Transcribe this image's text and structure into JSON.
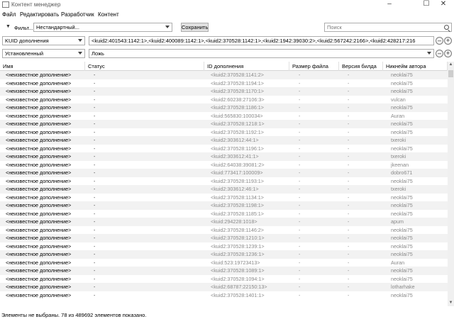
{
  "window": {
    "title": "Контент менеджер",
    "minimize": "–",
    "maximize": "☐",
    "close": "✕"
  },
  "menu": [
    "Файл",
    "Редактировать",
    "Разработчик",
    "Контент"
  ],
  "filter_bar": {
    "toggle": "▼",
    "label": "Фильт...",
    "preset": "Нестандартный...",
    "save_label": "Сохранить",
    "search_placeholder": "Поиск"
  },
  "filter_rows": [
    {
      "field": "KUID дополнения",
      "value": "<kuid2:401543:1142:1>,<kuid2:400089:1142:1>,<kuid2:370528:1142:1>,<kuid2:1942:39030:2>,<kuid2:567242:2166>,<kuid2:428217:216"
    },
    {
      "field": "Установленный",
      "value": "Ложь"
    }
  ],
  "row_buttons": {
    "remove": "–",
    "add": "+"
  },
  "columns": [
    "Имя",
    "Статус",
    "ID дополнения",
    "Размер файла",
    "Версия билда",
    "Никнейм автора"
  ],
  "rows": [
    {
      "name": "<неизвестное дополнение>",
      "status": "-",
      "kuid": "<kuid2:370528:1141:2>",
      "size": "-",
      "build": "-",
      "author": "neoklai75"
    },
    {
      "name": "<неизвестное дополнение>",
      "status": "-",
      "kuid": "<kuid2:370528:1194:1>",
      "size": "-",
      "build": "-",
      "author": "neoklai75"
    },
    {
      "name": "<неизвестное дополнение>",
      "status": "-",
      "kuid": "<kuid2:370528:1170:1>",
      "size": "-",
      "build": "-",
      "author": "neoklai75"
    },
    {
      "name": "<неизвестное дополнение>",
      "status": "-",
      "kuid": "<kuid2:60238:27106:3>",
      "size": "-",
      "build": "-",
      "author": "vulcan"
    },
    {
      "name": "<неизвестное дополнение>",
      "status": "-",
      "kuid": "<kuid2:370528:1186:1>",
      "size": "-",
      "build": "-",
      "author": "neoklai75"
    },
    {
      "name": "<неизвестное дополнение>",
      "status": "-",
      "kuid": "<kuid:565830:100034>",
      "size": "-",
      "build": "-",
      "author": "Auran"
    },
    {
      "name": "<неизвестное дополнение>",
      "status": "-",
      "kuid": "<kuid2:370528:1218:1>",
      "size": "-",
      "build": "-",
      "author": "neoklai75"
    },
    {
      "name": "<неизвестное дополнение>",
      "status": "-",
      "kuid": "<kuid2:370528:1192:1>",
      "size": "-",
      "build": "-",
      "author": "neoklai75"
    },
    {
      "name": "<неизвестное дополнение>",
      "status": "-",
      "kuid": "<kuid2:303612:44:1>",
      "size": "-",
      "build": "-",
      "author": "txeroki"
    },
    {
      "name": "<неизвестное дополнение>",
      "status": "-",
      "kuid": "<kuid2:370528:1196:1>",
      "size": "-",
      "build": "-",
      "author": "neoklai75"
    },
    {
      "name": "<неизвестное дополнение>",
      "status": "-",
      "kuid": "<kuid2:303612:41:1>",
      "size": "-",
      "build": "-",
      "author": "txeroki"
    },
    {
      "name": "<неизвестное дополнение>",
      "status": "-",
      "kuid": "<kuid2:64038:39081:2>",
      "size": "-",
      "build": "-",
      "author": "jkeenan"
    },
    {
      "name": "<неизвестное дополнение>",
      "status": "-",
      "kuid": "<kuid:773417:100009>",
      "size": "-",
      "build": "-",
      "author": "dobro671"
    },
    {
      "name": "<неизвестное дополнение>",
      "status": "-",
      "kuid": "<kuid2:370528:1193:1>",
      "size": "-",
      "build": "-",
      "author": "neoklai75"
    },
    {
      "name": "<неизвестное дополнение>",
      "status": "-",
      "kuid": "<kuid2:303612:46:1>",
      "size": "-",
      "build": "-",
      "author": "txeroki"
    },
    {
      "name": "<неизвестное дополнение>",
      "status": "-",
      "kuid": "<kuid2:370528:1134:1>",
      "size": "-",
      "build": "-",
      "author": "neoklai75"
    },
    {
      "name": "<неизвестное дополнение>",
      "status": "-",
      "kuid": "<kuid2:370528:1198:1>",
      "size": "-",
      "build": "-",
      "author": "neoklai75"
    },
    {
      "name": "<неизвестное дополнение>",
      "status": "-",
      "kuid": "<kuid2:370528:1185:1>",
      "size": "-",
      "build": "-",
      "author": "neoklai75"
    },
    {
      "name": "<неизвестное дополнение>",
      "status": "-",
      "kuid": "<kuid:294228:1018>",
      "size": "-",
      "build": "-",
      "author": "apum"
    },
    {
      "name": "<неизвестное дополнение>",
      "status": "-",
      "kuid": "<kuid2:370528:1146:2>",
      "size": "-",
      "build": "-",
      "author": "neoklai75"
    },
    {
      "name": "<неизвестное дополнение>",
      "status": "-",
      "kuid": "<kuid2:370528:1210:1>",
      "size": "-",
      "build": "-",
      "author": "neoklai75"
    },
    {
      "name": "<неизвестное дополнение>",
      "status": "-",
      "kuid": "<kuid2:370528:1239:1>",
      "size": "-",
      "build": "-",
      "author": "neoklai75"
    },
    {
      "name": "<неизвестное дополнение>",
      "status": "-",
      "kuid": "<kuid2:370528:1236:1>",
      "size": "-",
      "build": "-",
      "author": "neoklai75"
    },
    {
      "name": "<неизвестное дополнение>",
      "status": "-",
      "kuid": "<kuid:523:19723413>",
      "size": "-",
      "build": "-",
      "author": "Auran"
    },
    {
      "name": "<неизвестное дополнение>",
      "status": "-",
      "kuid": "<kuid2:370528:1089:1>",
      "size": "-",
      "build": "-",
      "author": "neoklai75"
    },
    {
      "name": "<неизвестное дополнение>",
      "status": "-",
      "kuid": "<kuid2:370528:1094:1>",
      "size": "-",
      "build": "-",
      "author": "neoklai75"
    },
    {
      "name": "<неизвестное дополнение>",
      "status": "-",
      "kuid": "<kuid2:68787:22150:13>",
      "size": "-",
      "build": "-",
      "author": "lotharhake"
    },
    {
      "name": "<неизвестное дополнение>",
      "status": "-",
      "kuid": "<kuid2:370528:1401:1>",
      "size": "-",
      "build": "-",
      "author": "neoklai75"
    }
  ],
  "scrollbar": {
    "up": "▲",
    "down": "▼"
  },
  "status": "Элементы не выбраны. 78 из 489692 элементов показано."
}
